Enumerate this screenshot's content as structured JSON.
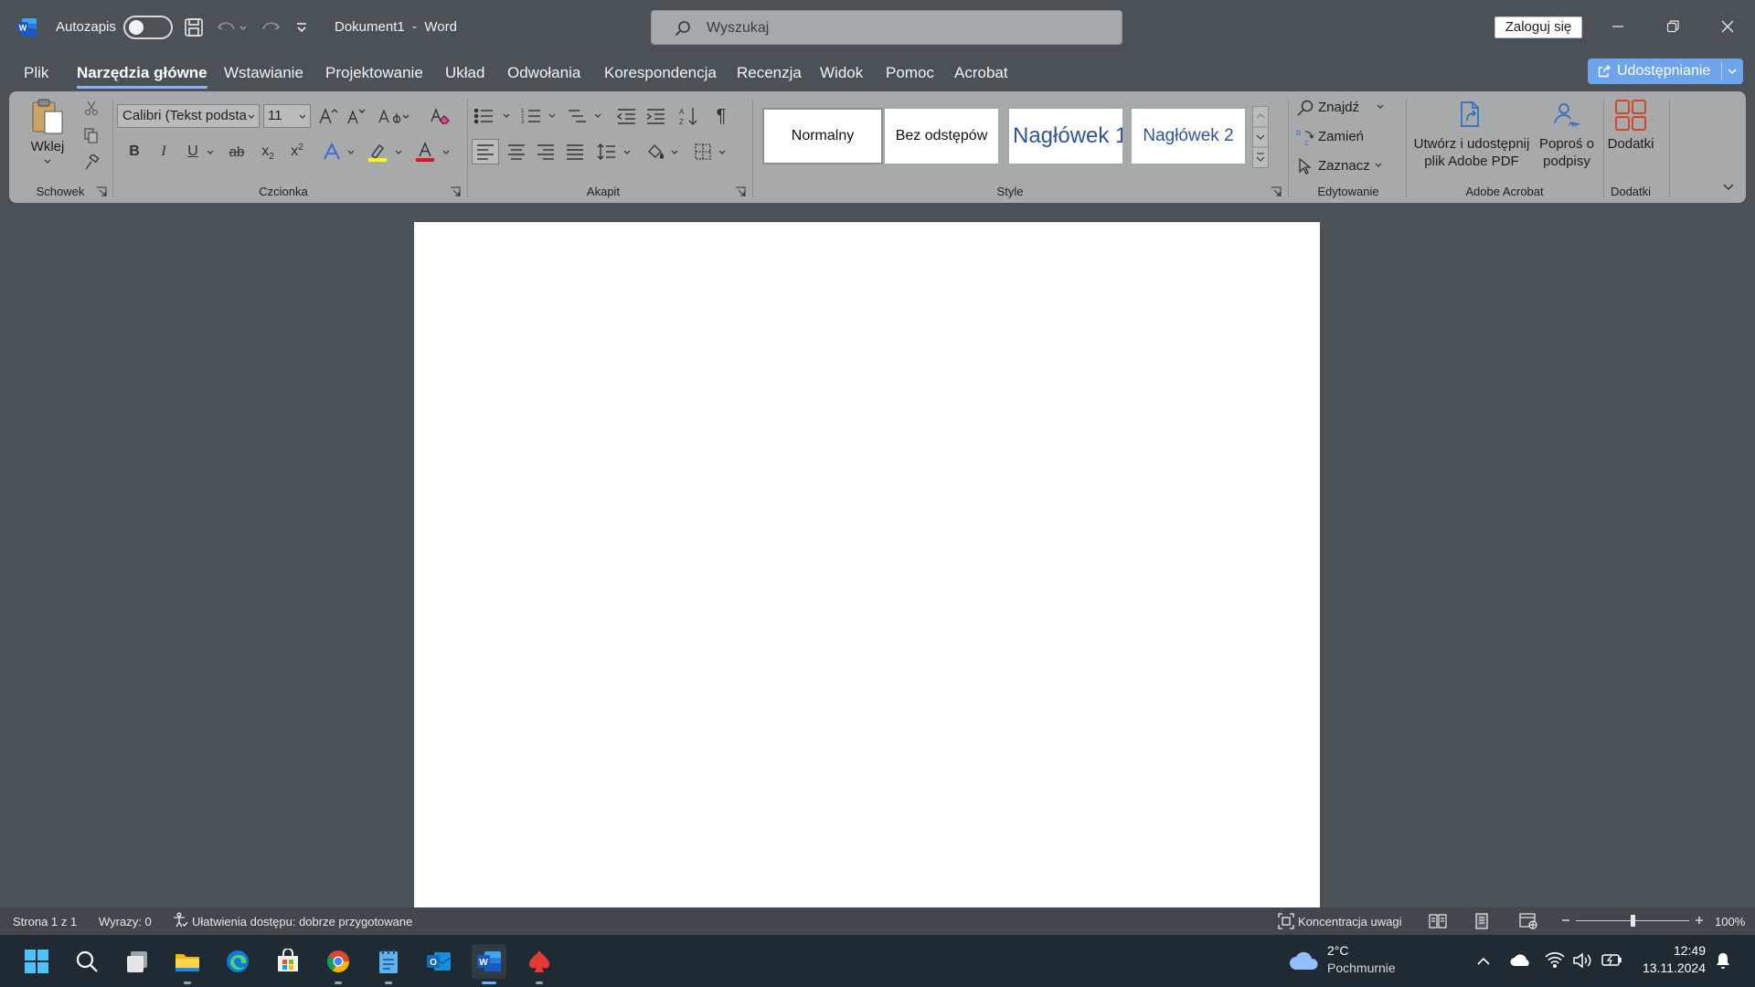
{
  "titlebar": {
    "autosave_label": "Autozapis",
    "document_title": "Dokument1  -  Word",
    "search_placeholder": "Wyszukaj",
    "signin_label": "Zaloguj się"
  },
  "menu_tabs": [
    {
      "label": "Plik",
      "active": false
    },
    {
      "label": "Narzędzia główne",
      "active": true
    },
    {
      "label": "Wstawianie",
      "active": false
    },
    {
      "label": "Projektowanie",
      "active": false
    },
    {
      "label": "Układ",
      "active": false
    },
    {
      "label": "Odwołania",
      "active": false
    },
    {
      "label": "Korespondencja",
      "active": false
    },
    {
      "label": "Recenzja",
      "active": false
    },
    {
      "label": "Widok",
      "active": false
    },
    {
      "label": "Pomoc",
      "active": false
    },
    {
      "label": "Acrobat",
      "active": false
    }
  ],
  "share_label": "Udostępnianie",
  "ribbon": {
    "clipboard": {
      "group_label": "Schowek",
      "paste_label": "Wklej"
    },
    "font": {
      "group_label": "Czcionka",
      "font_name": "Calibri (Tekst podsta",
      "font_size": "11"
    },
    "paragraph": {
      "group_label": "Akapit"
    },
    "styles": {
      "group_label": "Style",
      "items": [
        "Normalny",
        "Bez odstępów",
        "Nagłówek 1",
        "Nagłówek 2"
      ]
    },
    "editing": {
      "group_label": "Edytowanie",
      "find_label": "Znajdź",
      "replace_label": "Zamień",
      "select_label": "Zaznacz"
    },
    "acrobat": {
      "group_label": "Adobe Acrobat",
      "create_pdf_label": "Utwórz i udostępnij plik Adobe PDF",
      "request_sign_label": "Poproś o podpisy"
    },
    "addins": {
      "group_label": "Dodatki",
      "addins_label": "Dodatki"
    }
  },
  "statusbar": {
    "page_info": "Strona 1 z 1",
    "word_count": "Wyrazy: 0",
    "accessibility": "Ułatwienia dostępu: dobrze przygotowane",
    "focus_label": "Koncentracja uwagi",
    "zoom": "100%",
    "zoom_level": 0.5
  },
  "taskbar": {
    "weather_temp": "2°C",
    "weather_desc": "Pochmurnie",
    "time": "12:49",
    "date": "13.11.2024"
  },
  "colors": {
    "background": "#4a5157",
    "ribbon": "#a7a9ab",
    "accent_share": "#6ea4eb",
    "word_blue": "#185abd",
    "taskbar": "#1f2a33"
  }
}
